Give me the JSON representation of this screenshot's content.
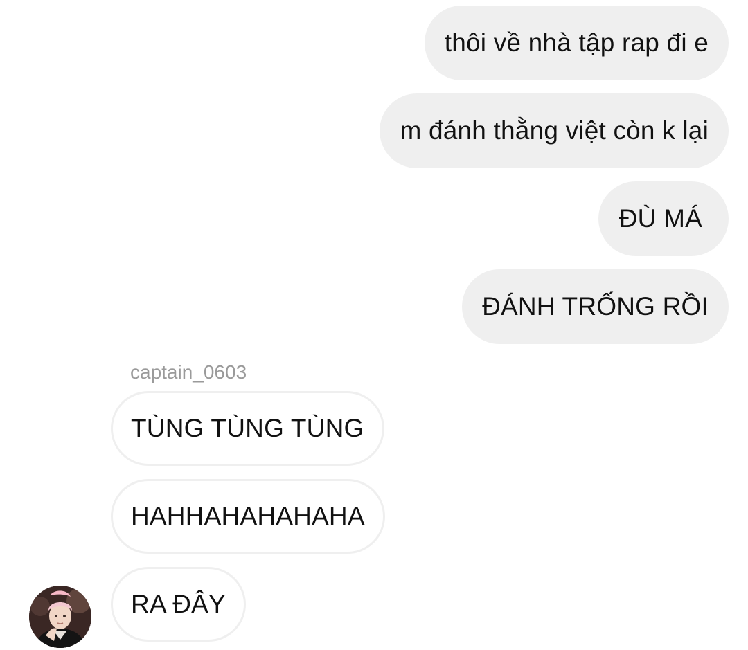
{
  "conversation": {
    "sent_messages": [
      {
        "text": "thôi về nhà tập rap đi e"
      },
      {
        "text": "m đánh thằng việt còn k lại"
      },
      {
        "text": "ĐÙ MÁ"
      },
      {
        "text": "ĐÁNH TRỐNG RỒI"
      }
    ],
    "other_user": {
      "username": "captain_0603",
      "avatar": "profile-photo"
    },
    "received_messages": [
      {
        "text": "TÙNG TÙNG TÙNG"
      },
      {
        "text": "HAHHAHAHAHAHA"
      },
      {
        "text": "RA ĐÂY"
      }
    ]
  },
  "colors": {
    "sent_bubble": "#efefef",
    "received_bubble_border": "#efefef",
    "username_text": "#9a9a9a",
    "message_text": "#111111",
    "background": "#ffffff"
  }
}
